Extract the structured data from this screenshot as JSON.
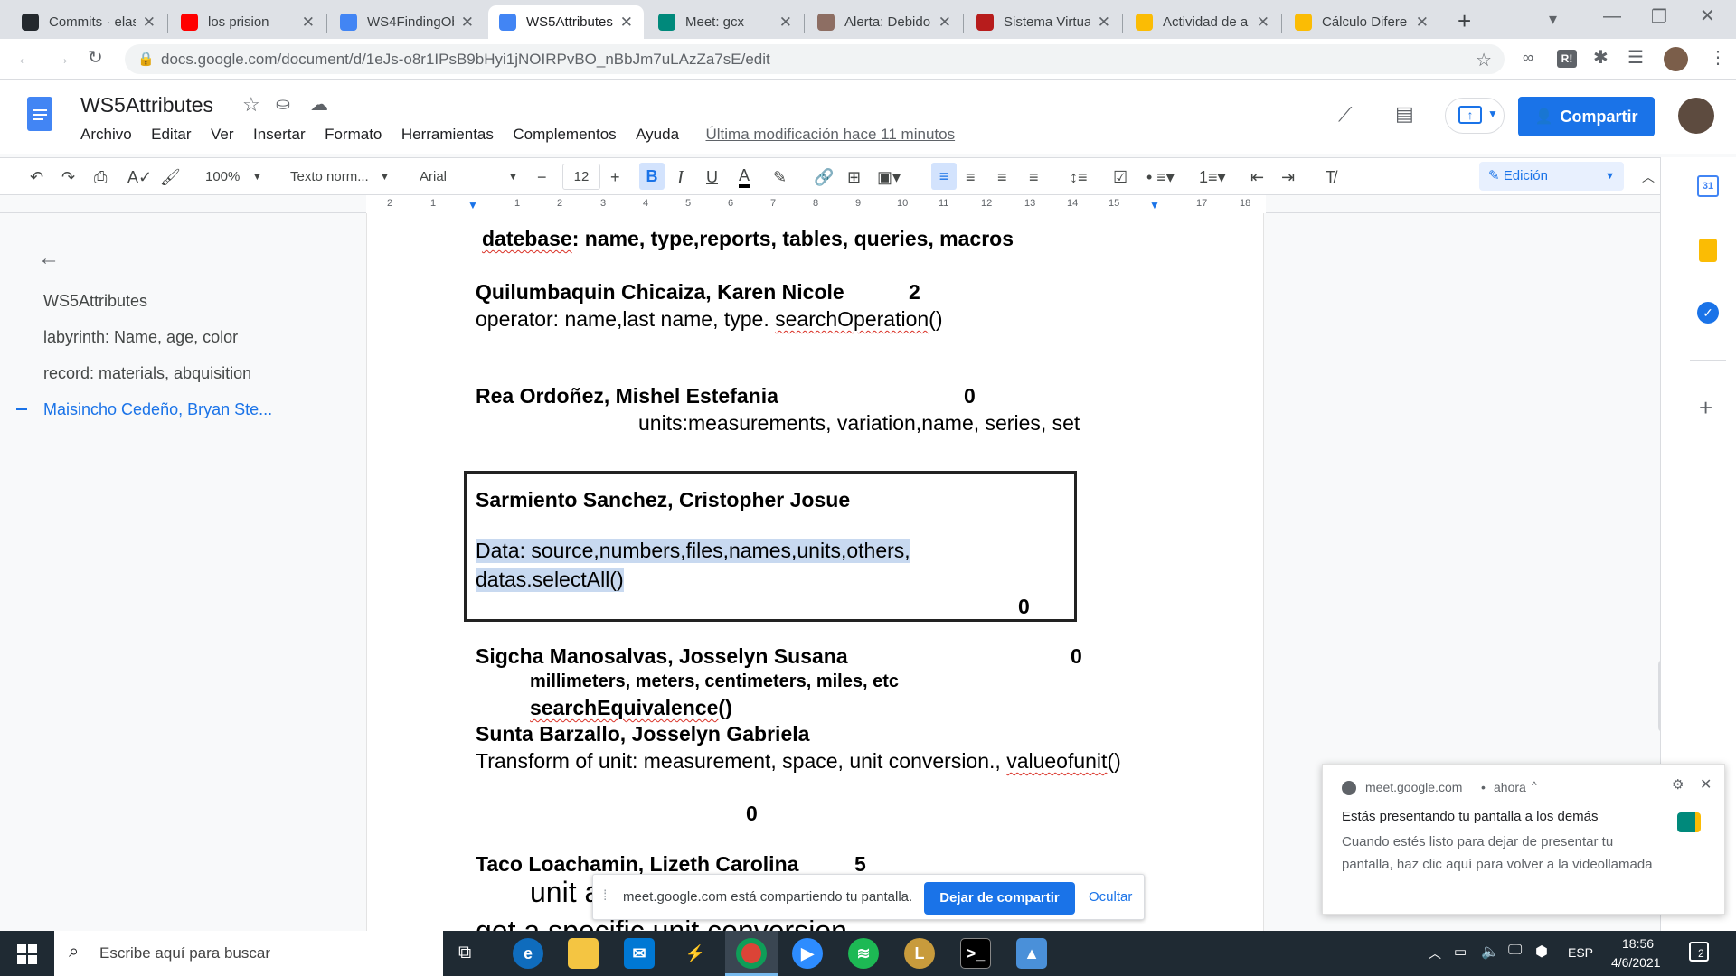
{
  "browser": {
    "tabs": [
      {
        "title": "Commits · elas",
        "favicon": "github-icon",
        "color": "#24292e"
      },
      {
        "title": "los prision",
        "favicon": "youtube-icon",
        "color": "#ff0000"
      },
      {
        "title": "WS4FindingOb",
        "favicon": "docs-icon",
        "color": "#4285f4"
      },
      {
        "title": "WS5Attributes",
        "favicon": "docs-icon",
        "color": "#4285f4"
      },
      {
        "title": "Meet: gcx",
        "favicon": "meet-icon",
        "color": "#00897b"
      },
      {
        "title": "Alerta: Debido",
        "favicon": "alert-icon",
        "color": "#8d6e63"
      },
      {
        "title": "Sistema Virtua",
        "favicon": "sistema-icon",
        "color": "#b71c1c"
      },
      {
        "title": "Actividad de a",
        "favicon": "drive-icon",
        "color": "#fbbc04"
      },
      {
        "title": "Cálculo Difere",
        "favicon": "drive-icon",
        "color": "#fbbc04"
      }
    ],
    "url": "docs.google.com/document/d/1eJs-o8r1IPsB9bHyi1jNOIRPvBO_nBbJm7uLAzZa7sE/edit",
    "extension_badge": "R!"
  },
  "docs": {
    "title": "WS5Attributes",
    "menu": [
      "Archivo",
      "Editar",
      "Ver",
      "Insertar",
      "Formato",
      "Herramientas",
      "Complementos",
      "Ayuda"
    ],
    "last_modified": "Última modificación hace 11 minutos",
    "share_label": "Compartir",
    "toolbar": {
      "zoom": "100%",
      "style": "Texto norm...",
      "font": "Arial",
      "font_size": "12",
      "mode": "Edición"
    },
    "ruler_labels": [
      "2",
      "1",
      "1",
      "2",
      "3",
      "4",
      "5",
      "6",
      "7",
      "8",
      "9",
      "10",
      "11",
      "12",
      "13",
      "14",
      "15",
      "17",
      "18"
    ],
    "outline": {
      "items": [
        "WS5Attributes",
        "labyrinth: Name, age, color",
        "record: materials, abquisition",
        "Maisincho Cedeño, Bryan Ste..."
      ]
    },
    "content": {
      "l1_word": "datebase",
      "l1_rest": ": name, type,reports, tables, queries, macros",
      "p2_name": "Quilumbaquin Chicaiza, Karen Nicole",
      "p2_score": "2",
      "p2_line_a": "operator: name,last name, type. ",
      "p2_line_b": "searchOperation",
      "p2_line_c": "()",
      "p3_name": "Rea Ordoñez, Mishel Estefania",
      "p3_score": "0",
      "p3_line": "units:measurements, variation,name, series, set",
      "p4_name": "Sarmiento Sanchez, Cristopher Josue",
      "p4_line1": "Data: source,numbers,files,names,units,others,",
      "p4_line2": "datas.selectAll()",
      "p4_score": "0",
      "p5_name": "Sigcha Manosalvas, Josselyn Susana",
      "p5_score": "0",
      "p5_line1": "millimeters, meters, centimeters, miles, etc",
      "p5_line2_a": "searchEquivalence",
      "p5_line2_b": "()",
      "p6_name": "Sunta Barzallo, Josselyn Gabriela",
      "p6_line_a": "Transform of unit: measurement, space, unit conversion., ",
      "p6_line_b": "valueofunit",
      "p6_line_c": "()",
      "p6_score": "0",
      "p7_name": "Taco Loachamin, Lizeth Carolina",
      "p7_score": "5",
      "p7_line1": "unit a",
      "p7_line2": "get a specific unit conversion"
    }
  },
  "share_banner": {
    "text": "meet.google.com está compartiendo tu pantalla.",
    "stop_label": "Dejar de compartir",
    "hide_label": "Ocultar"
  },
  "notification": {
    "source": "meet.google.com",
    "time": "ahora",
    "title": "Estás presentando tu pantalla a los demás",
    "body": "Cuando estés listo para dejar de presentar tu pantalla, haz clic aquí para volver a la videollamada"
  },
  "taskbar": {
    "search_placeholder": "Escribe aquí para buscar",
    "language": "ESP",
    "time": "18:56",
    "date": "4/6/2021",
    "notif_count": "2"
  },
  "colors": {
    "accent": "#1a73e8",
    "selection": "#c8d9f0"
  }
}
